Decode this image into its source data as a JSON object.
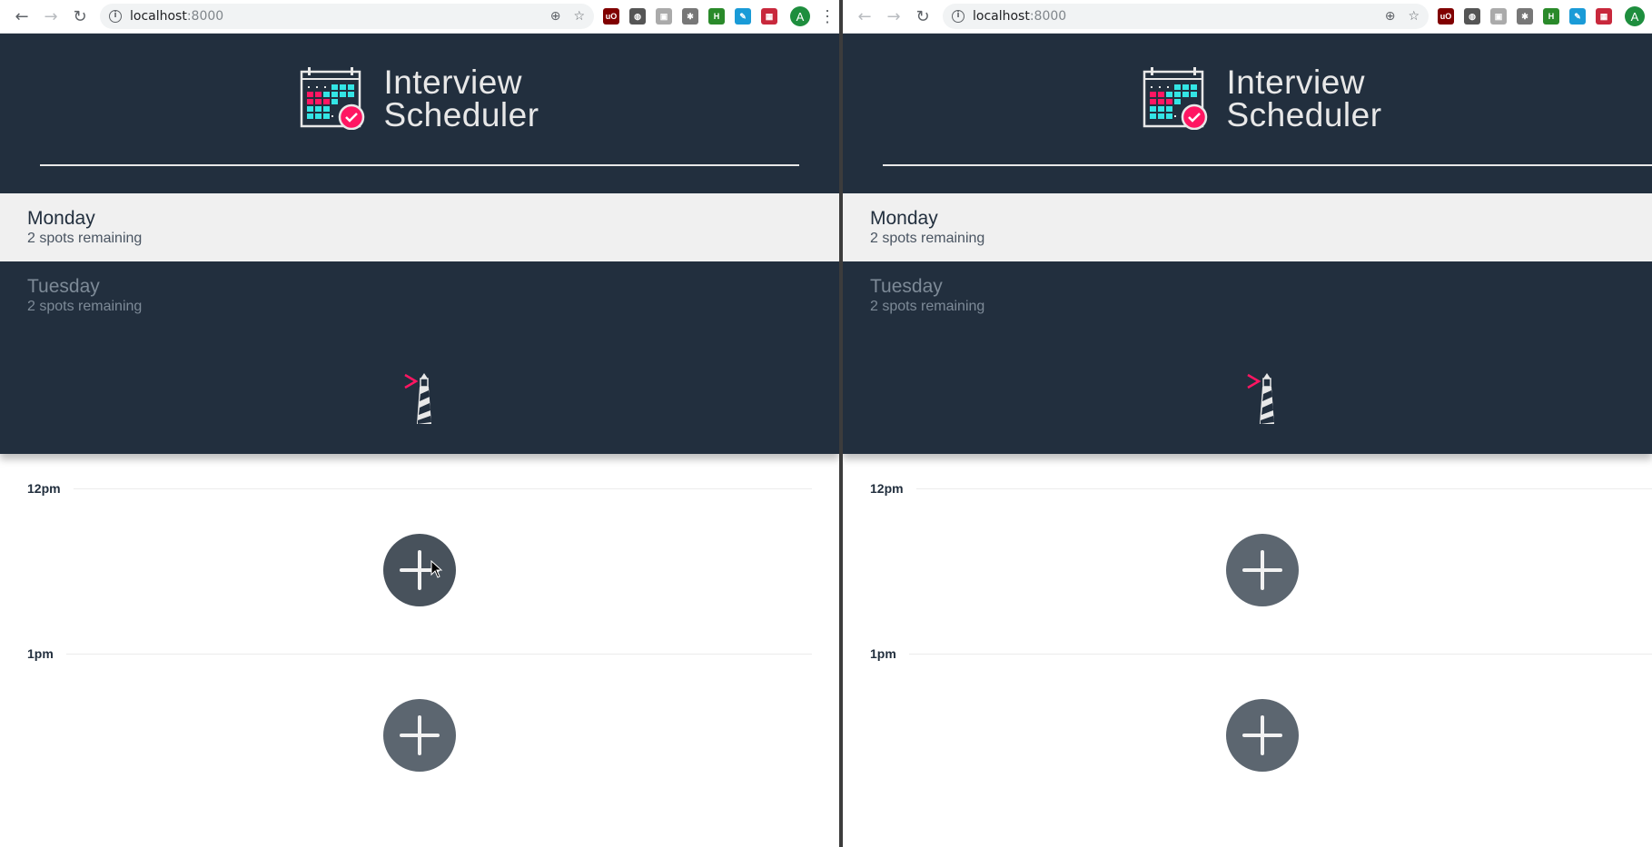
{
  "browser": {
    "url_host": "localhost",
    "url_port": ":8000",
    "avatar_initial": "A",
    "extensions": [
      "uBlock",
      "Privacy Badger",
      "screenshot",
      "bug",
      "HTML",
      "highlighter",
      "extension"
    ]
  },
  "app": {
    "brand_line1": "Interview",
    "brand_line2": "Scheduler",
    "colors": {
      "sidebar": "#222f3e",
      "selected_day": "#f0f0f0",
      "accent": "#ff1662",
      "teal": "#33e5e5",
      "add_button": "#5c6670"
    }
  },
  "days": [
    {
      "name": "Monday",
      "spots": "2 spots remaining",
      "selected": true
    },
    {
      "name": "Tuesday",
      "spots": "2 spots remaining",
      "selected": false
    }
  ],
  "appointments": [
    {
      "time": "12pm",
      "action_icon": "plus-icon"
    },
    {
      "time": "1pm",
      "action_icon": "plus-icon"
    }
  ]
}
